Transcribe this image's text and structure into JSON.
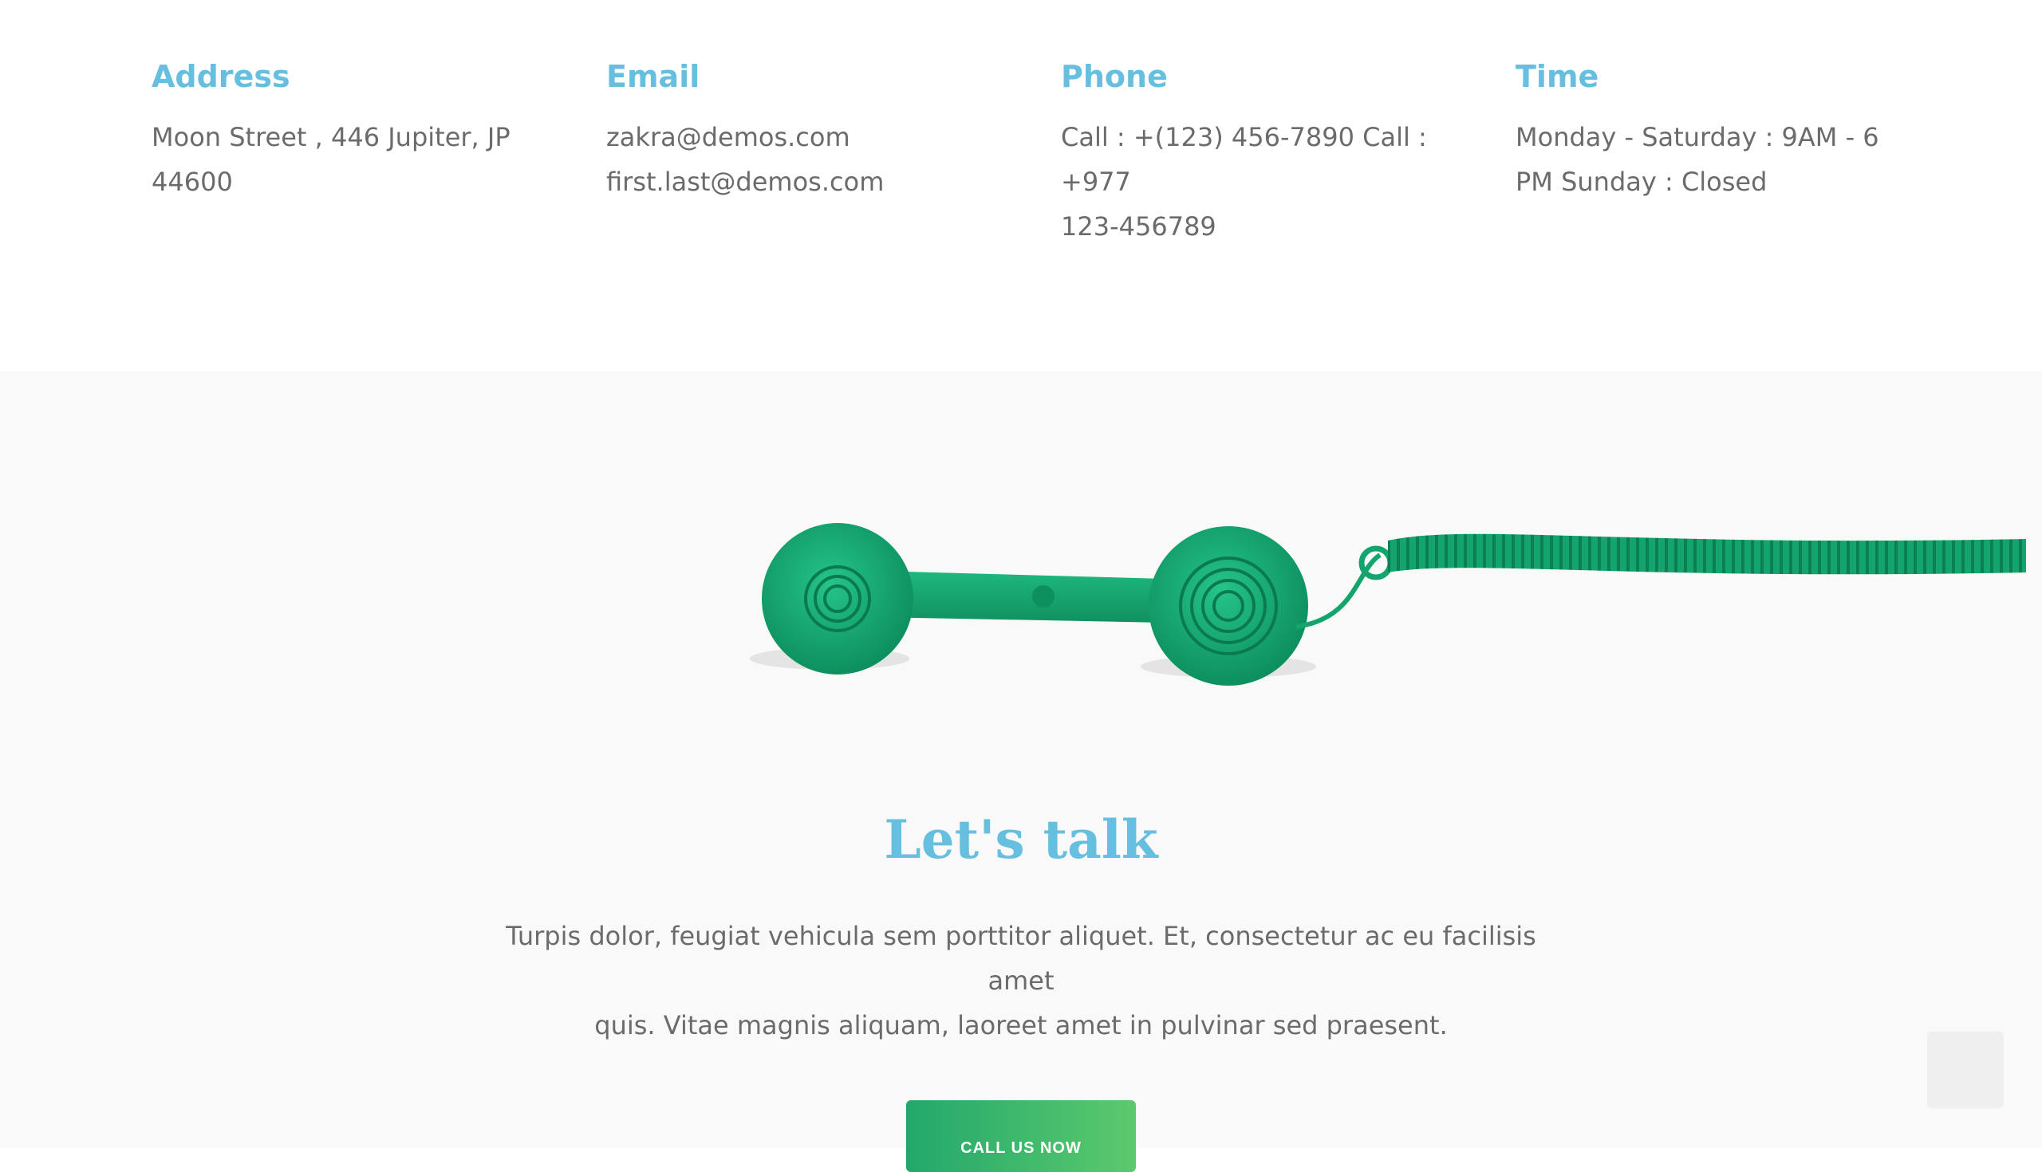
{
  "contact": {
    "address": {
      "heading": "Address",
      "lines": [
        "Moon Street , 446 Jupiter, JP",
        "44600"
      ]
    },
    "email": {
      "heading": "Email",
      "lines": [
        "zakra@demos.com",
        "first.last@demos.com"
      ]
    },
    "phone": {
      "heading": "Phone",
      "lines": [
        "Call : +(123) 456-7890 Call : +977",
        "123-456789"
      ]
    },
    "time": {
      "heading": "Time",
      "lines": [
        "Monday - Saturday : 9AM - 6",
        "PM Sunday : Closed"
      ]
    }
  },
  "talk": {
    "title": "Let's talk",
    "text_lines": [
      "Turpis dolor, feugiat vehicula sem porttitor aliquet. Et, consectetur ac eu facilisis amet",
      "quis. Vitae magnis aliquam, laoreet amet in pulvinar sed praesent."
    ],
    "button_label": "CALL US NOW",
    "image_icon": "green-telephone-handset"
  },
  "colors": {
    "accent": "#66bfdf",
    "button_start": "#22a86b",
    "button_end": "#5cc96d",
    "text": "#6b6b6b",
    "section_bg": "#f9f9f9",
    "phone_green": "#17a673"
  },
  "scroll_top_icon": "scroll-top-icon"
}
